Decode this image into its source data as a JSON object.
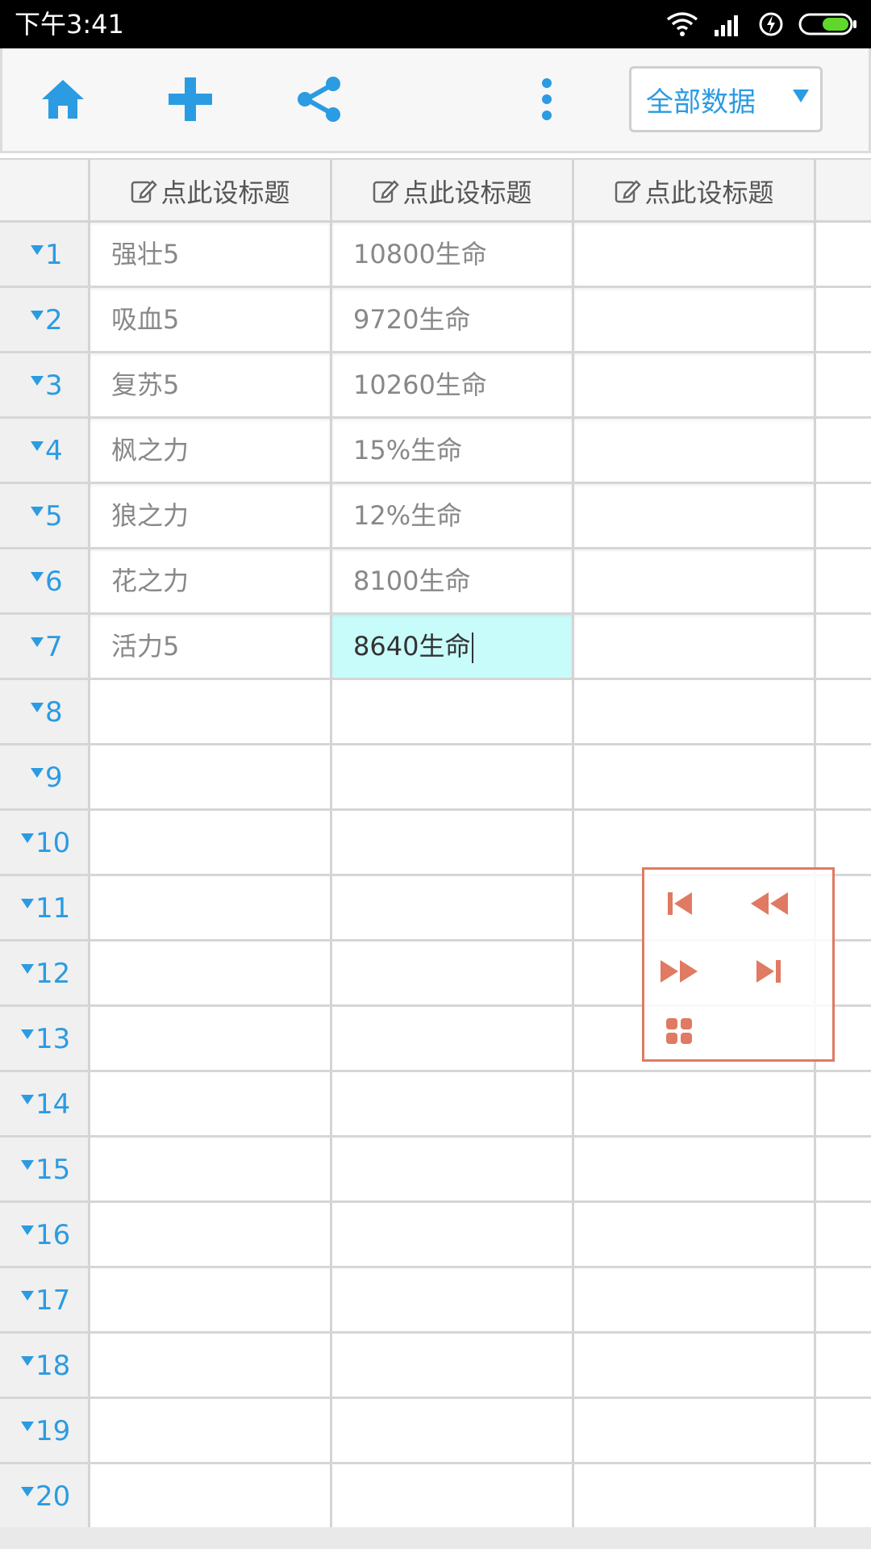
{
  "status_bar": {
    "time": "下午3:41"
  },
  "toolbar": {
    "icons": [
      "home-icon",
      "add-icon",
      "share-icon",
      "more-vert-icon"
    ],
    "filter_select": "全部数据"
  },
  "columns": [
    "点此设标题",
    "点此设标题",
    "点此设标题"
  ],
  "rows": [
    {
      "num": "1",
      "c1": "强壮5",
      "c2": "10800生命",
      "c3": ""
    },
    {
      "num": "2",
      "c1": "吸血5",
      "c2": "9720生命",
      "c3": ""
    },
    {
      "num": "3",
      "c1": "复苏5",
      "c2": "10260生命",
      "c3": ""
    },
    {
      "num": "4",
      "c1": "枫之力",
      "c2": "15%生命",
      "c3": ""
    },
    {
      "num": "5",
      "c1": "狼之力",
      "c2": "12%生命",
      "c3": ""
    },
    {
      "num": "6",
      "c1": "花之力",
      "c2": "8100生命",
      "c3": ""
    },
    {
      "num": "7",
      "c1": "活力5",
      "c2": "8640生命",
      "c3": ""
    },
    {
      "num": "8",
      "c1": "",
      "c2": "",
      "c3": ""
    },
    {
      "num": "9",
      "c1": "",
      "c2": "",
      "c3": ""
    },
    {
      "num": "10",
      "c1": "",
      "c2": "",
      "c3": ""
    },
    {
      "num": "11",
      "c1": "",
      "c2": "",
      "c3": ""
    },
    {
      "num": "12",
      "c1": "",
      "c2": "",
      "c3": ""
    },
    {
      "num": "13",
      "c1": "",
      "c2": "",
      "c3": ""
    },
    {
      "num": "14",
      "c1": "",
      "c2": "",
      "c3": ""
    },
    {
      "num": "15",
      "c1": "",
      "c2": "",
      "c3": ""
    },
    {
      "num": "16",
      "c1": "",
      "c2": "",
      "c3": ""
    },
    {
      "num": "17",
      "c1": "",
      "c2": "",
      "c3": ""
    },
    {
      "num": "18",
      "c1": "",
      "c2": "",
      "c3": ""
    },
    {
      "num": "19",
      "c1": "",
      "c2": "",
      "c3": ""
    },
    {
      "num": "20",
      "c1": "",
      "c2": "",
      "c3": ""
    }
  ],
  "active_cell": {
    "row": "7",
    "column": "2"
  },
  "pager": {
    "icons": [
      "first-page-icon",
      "rewind-icon",
      "fast-forward-icon",
      "last-page-icon",
      "grid-menu-icon"
    ],
    "color": "#e07a62"
  },
  "colors": {
    "accent": "#2b9be2",
    "active_cell_bg": "#c8fcfb"
  }
}
